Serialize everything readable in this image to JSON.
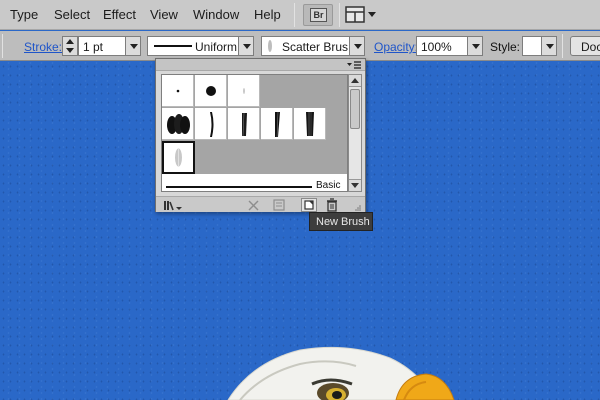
{
  "menubar": {
    "items": [
      {
        "label": "Type"
      },
      {
        "label": "Select"
      },
      {
        "label": "Effect"
      },
      {
        "label": "View"
      },
      {
        "label": "Window"
      },
      {
        "label": "Help"
      }
    ],
    "bridge_button": {
      "label": "Br",
      "icon": "bridge-icon"
    },
    "arrange_button": {
      "icon": "arrange-documents-icon"
    }
  },
  "controlbar": {
    "stroke_label": "Stroke:",
    "stroke_weight": "1 pt",
    "variable_width_profile": "Uniform",
    "brush_definition": "Scatter Brus...",
    "opacity_label": "Opacity:",
    "opacity_value": "100%",
    "style_label": "Style:",
    "doc_button_label": "Doc"
  },
  "brush_panel": {
    "menu_icon": "panel-menu-icon",
    "art_brush_label": "Basic",
    "footer_icons": [
      "brush-libraries-icon",
      "remove-brush-stroke-icon",
      "options-icon",
      "new-brush-icon",
      "delete-brush-icon"
    ]
  },
  "tooltip": {
    "text": "New Brush"
  },
  "colors": {
    "canvas_sky": "#2a68c8",
    "tooltip_bg": "#3d3d3d",
    "link_blue": "#1f55c9"
  }
}
